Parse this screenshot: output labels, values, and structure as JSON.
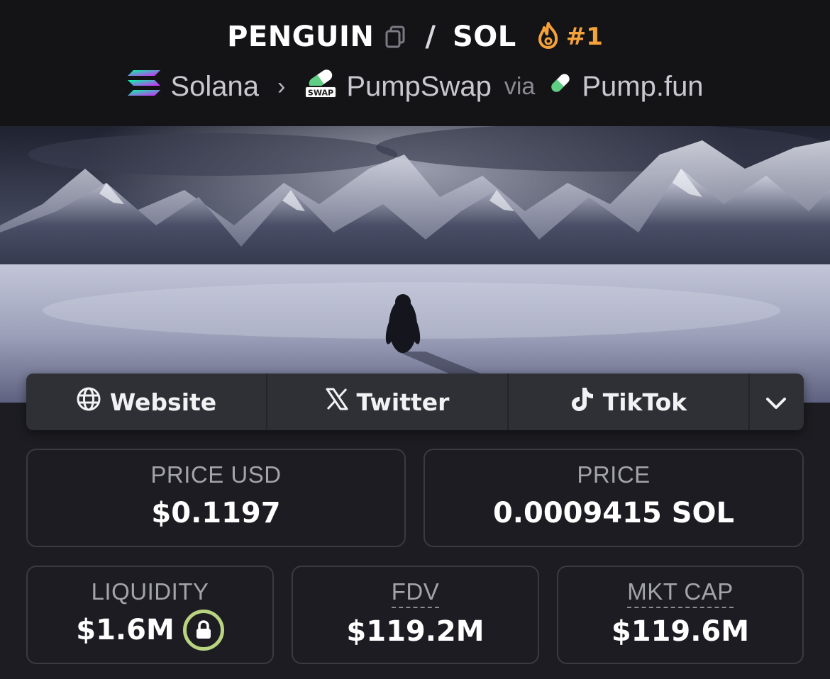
{
  "header": {
    "base_symbol": "PENGUIN",
    "separator": "/",
    "quote_symbol": "SOL",
    "rank": "#1",
    "colors": {
      "rank": "#f5a23a",
      "background": "#141417"
    },
    "breadcrumb": {
      "chain": "Solana",
      "dex": "PumpSwap",
      "dex_badge": "SWAP",
      "via_label": "via",
      "launchpad": "Pump.fun"
    }
  },
  "banner": {
    "icon": "penguin-mountains-image"
  },
  "social": {
    "website": "Website",
    "twitter": "Twitter",
    "tiktok": "TikTok",
    "more_icon": "chevron-down-icon"
  },
  "stats": {
    "price_usd": {
      "label": "PRICE USD",
      "value": "$0.1197"
    },
    "price_native": {
      "label": "PRICE",
      "value": "0.0009415 SOL"
    },
    "liquidity": {
      "label": "LIQUIDITY",
      "value": "$1.6M",
      "lock_icon": "lock-icon",
      "lock_color": "#b9d480"
    },
    "fdv": {
      "label": "FDV",
      "value": "$119.2M"
    },
    "mkt_cap": {
      "label": "MKT CAP",
      "value": "$119.6M"
    }
  }
}
